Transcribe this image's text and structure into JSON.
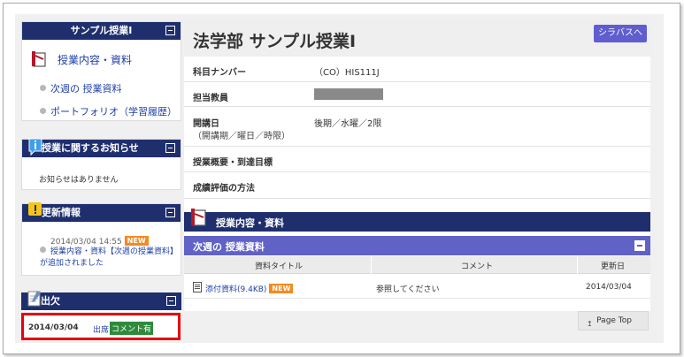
{
  "sidebar": {
    "course_panel": {
      "title": "サンプル授業Ⅰ",
      "main_link": "授業内容・資料",
      "links": [
        "次週の 授業資料",
        "ポートフォリオ（学習履歴）"
      ]
    },
    "notice_panel": {
      "title": "授業に関するお知らせ",
      "empty_text": "お知らせはありません"
    },
    "update_panel": {
      "title": "更新情報",
      "date": "2014/03/04 14:55",
      "badge": "NEW",
      "text": "授業内容・資料【次週の授業資料】が追加されました"
    },
    "attendance_panel": {
      "title": "出欠",
      "date": "2014/03/04",
      "status": "出席",
      "comment_badge": "コメント有"
    }
  },
  "main": {
    "title": "法学部 サンプル授業Ⅰ",
    "syllabus_button": "シラバスへ",
    "info": {
      "course_number_label": "科目ナンバー",
      "course_number": "（CO）HIS111J",
      "instructor_label": "担当教員",
      "schedule_label": "開講日",
      "schedule_sub": "（開講期／曜日／時限）",
      "schedule_value": "後期／水曜／2限",
      "overview_label": "授業概要・到達目標",
      "evaluation_label": "成績評価の方法"
    },
    "section_title": "授業内容・資料",
    "subsection_title": "次週の 授業資料",
    "table": {
      "headers": [
        "資料タイトル",
        "コメント",
        "更新日"
      ],
      "rows": [
        {
          "title": "添付資料(9.4KB)",
          "badge": "NEW",
          "comment": "参照してください",
          "updated": "2014/03/04"
        }
      ]
    },
    "page_top": "Page Top"
  }
}
